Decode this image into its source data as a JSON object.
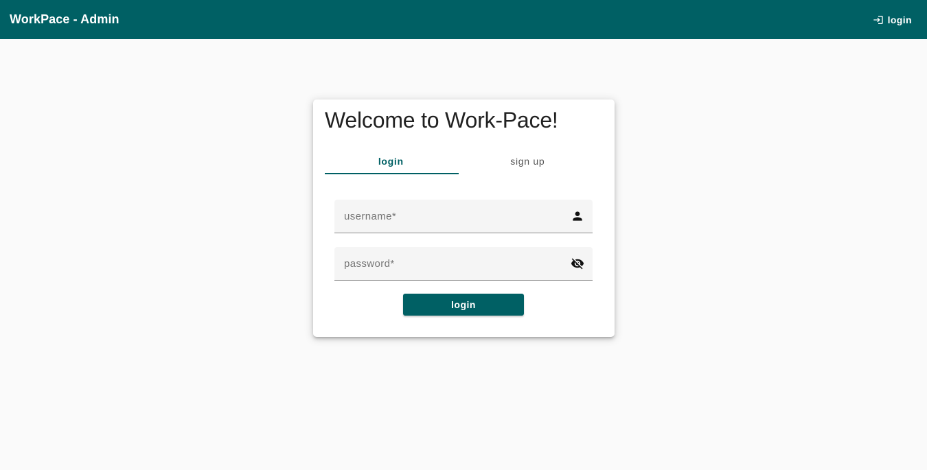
{
  "toolbar": {
    "title": "WorkPace - Admin",
    "login_label": "login",
    "login_icon": "login-icon",
    "background": "#006064"
  },
  "card": {
    "title": "Welcome to Work-Pace!",
    "tabs": [
      {
        "label": "login",
        "active": true
      },
      {
        "label": "sign up",
        "active": false
      }
    ],
    "username": {
      "placeholder": "username*",
      "value": "",
      "icon": "person-icon"
    },
    "password": {
      "placeholder": "password*",
      "value": "",
      "icon": "visibility-off-icon"
    },
    "submit_label": "login"
  },
  "colors": {
    "accent": "#006064",
    "page_background": "#fafafa",
    "field_background": "#f5f5f5"
  }
}
